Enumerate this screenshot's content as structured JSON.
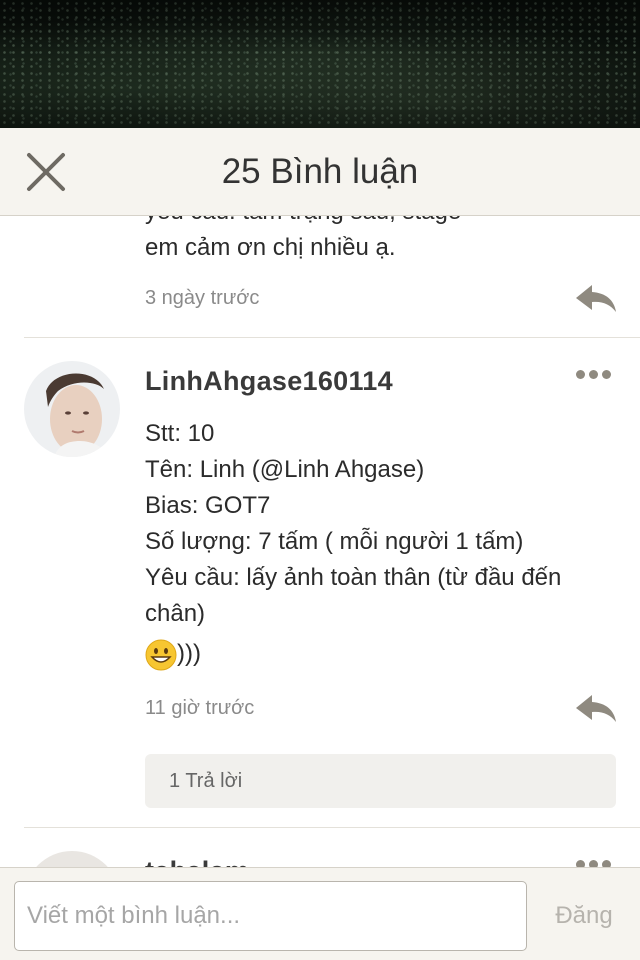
{
  "header": {
    "title": "25 Bình luận"
  },
  "comments": [
    {
      "text_lines": [
        "yêu cầu: tâm trạng sầu, stage",
        "em cảm ơn chị nhiều ạ."
      ],
      "time": "3 ngày trước"
    },
    {
      "username": "LinhAhgase160114",
      "text_lines": [
        "Stt: 10",
        "Tên: Linh (@Linh Ahgase)",
        "Bias: GOT7",
        "Số lượng: 7 tấm ( mỗi người 1 tấm)",
        "Yêu cầu: lấy ảnh toàn thân (từ đầu đến",
        "chân)"
      ],
      "emoji_suffix": ")))",
      "time": "11 giờ trước",
      "replies_label": "1 Trả lời"
    },
    {
      "username": "tahalam"
    }
  ],
  "footer": {
    "input_placeholder": "Viết một bình luận...",
    "post_label": "Đăng"
  },
  "icons": {
    "close": "close-icon",
    "reply": "reply-arrow-icon",
    "more": "more-options-icon",
    "emoji": "grinning-face-emoji"
  },
  "colors": {
    "header_bg": "#f6f4ef",
    "icon_gray": "#8f8a80",
    "time_gray": "#8a8a8a"
  }
}
